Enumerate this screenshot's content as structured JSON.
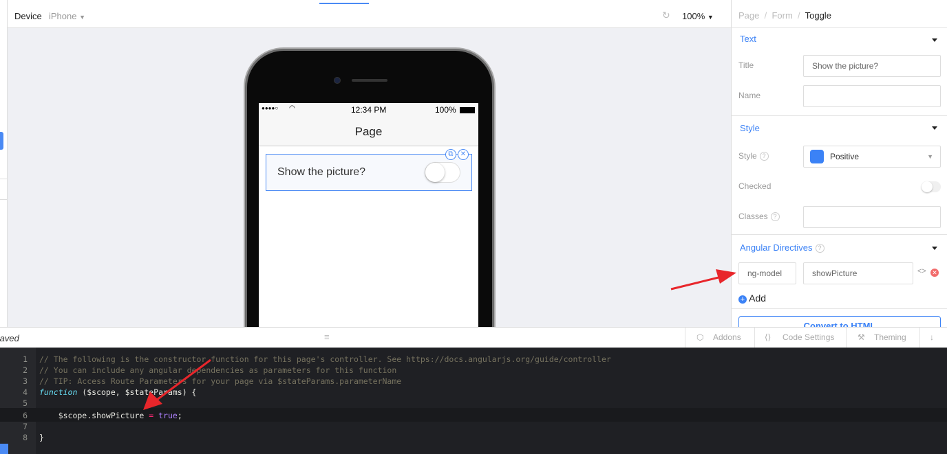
{
  "toolbar": {
    "device_label": "Device",
    "device_value": "iPhone",
    "zoom": "100%"
  },
  "phone": {
    "carrier": "●●●●○",
    "time": "12:34 PM",
    "battery": "100%",
    "nav_title": "Page",
    "toggle_label": "Show the picture?",
    "toggle_checked": false
  },
  "breadcrumb": [
    "Page",
    "Form",
    "Toggle"
  ],
  "panel": {
    "text_section": {
      "title": "Text",
      "fields": {
        "title_label": "Title",
        "title_value": "Show the picture?",
        "name_label": "Name",
        "name_value": ""
      }
    },
    "style_section": {
      "title": "Style",
      "style_label": "Style",
      "style_value": "Positive",
      "style_color": "#3b82f6",
      "checked_label": "Checked",
      "checked": false,
      "classes_label": "Classes",
      "classes_value": ""
    },
    "directives_section": {
      "title": "Angular Directives",
      "directive_name": "ng-model",
      "directive_value": "showPicture",
      "add_label": "Add"
    },
    "button_label": "Convert to HTML"
  },
  "bottombar": {
    "status": "Saved",
    "tabs": [
      "Addons",
      "Code Settings",
      "Theming"
    ]
  },
  "code": {
    "lines": [
      "// The following is the constructor function for this page's controller. See https://docs.angularjs.org/guide/controller",
      "// You can include any angular dependencies as parameters for this function",
      "// TIP: Access Route Parameters for your page via $stateParams.parameterName",
      "function ($scope, $stateParams) {",
      "",
      "    $scope.showPicture = true;",
      "",
      "}"
    ]
  },
  "colors": {
    "accent": "#4a8af4",
    "annotation_arrow": "#e8262b"
  }
}
